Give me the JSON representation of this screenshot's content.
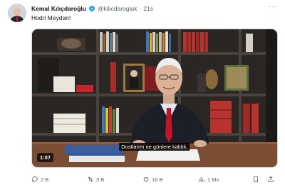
{
  "tweet": {
    "author_name": "Kemal Kılıçdaroğlu",
    "handle": "@kilicdarogluk",
    "separator": "·",
    "time": "21s",
    "text": "Hodri  Meydan!",
    "more": "···"
  },
  "video": {
    "duration": "1:07",
    "subtitle": "Dostlarım ne günlere kaldık."
  },
  "actions": {
    "replies": "2 B",
    "retweets": "3 B",
    "likes": "16 B",
    "views": "1 Mn"
  },
  "colors": {
    "text": "#0f1419",
    "secondary": "#536471",
    "verified": "#1d9bf0"
  },
  "icons": [
    "verified-badge-icon",
    "more-icon",
    "reply-icon",
    "retweet-icon",
    "like-icon",
    "views-icon",
    "bookmark-icon",
    "share-icon"
  ]
}
